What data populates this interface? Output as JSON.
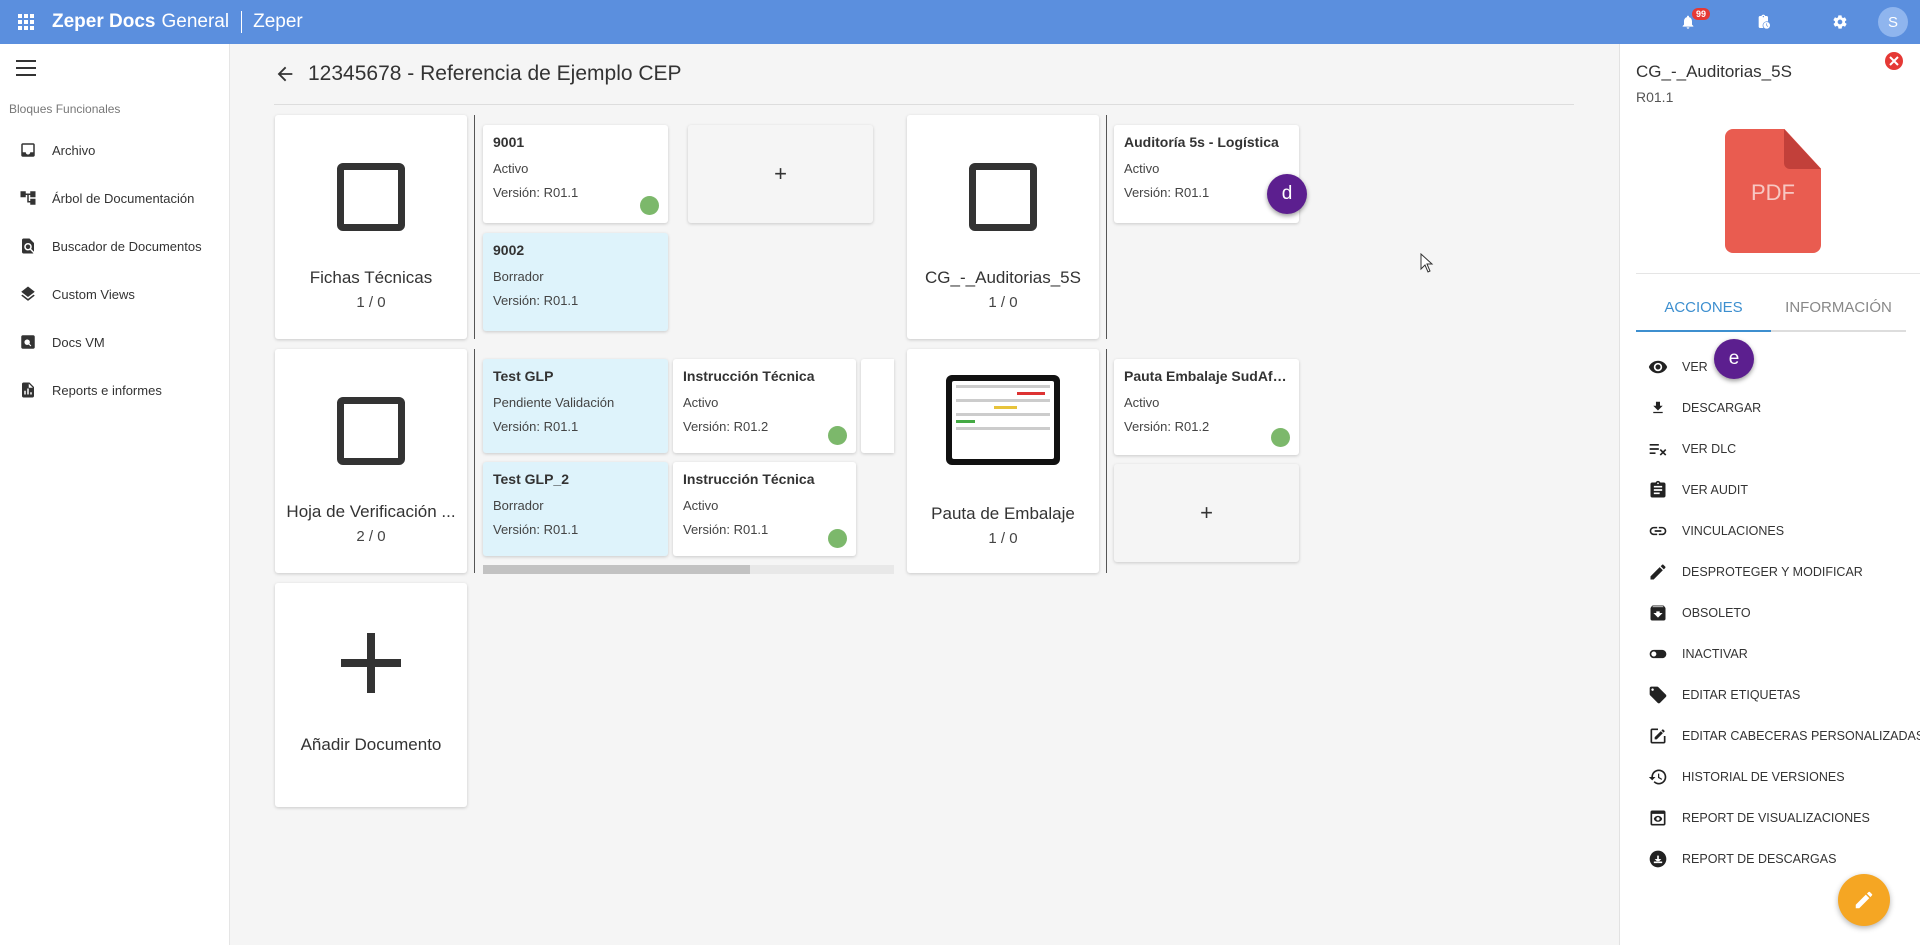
{
  "topbar": {
    "brand_bold": "Zeper Docs",
    "brand_light": "General",
    "company": "Zeper",
    "notification_count": "99",
    "avatar_letter": "S",
    "icons": [
      "apps-grid-icon",
      "bell-icon",
      "clipboard-clock-icon",
      "gear-icon"
    ]
  },
  "sidebar": {
    "section_title": "Bloques Funcionales",
    "items": [
      {
        "label": "Archivo",
        "icon": "inbox-icon"
      },
      {
        "label": "Árbol de Documentación",
        "icon": "tree-icon"
      },
      {
        "label": "Buscador de Documentos",
        "icon": "doc-search-icon"
      },
      {
        "label": "Custom Views",
        "icon": "layers-icon"
      },
      {
        "label": "Docs VM",
        "icon": "image-search-icon"
      },
      {
        "label": "Reports e informes",
        "icon": "report-icon"
      }
    ]
  },
  "main": {
    "title": "12345678 - Referencia de Ejemplo CEP",
    "blocks": [
      {
        "name": "Fichas Técnicas",
        "count": "1 / 0"
      },
      {
        "name": "CG_-_Auditorias_5S",
        "count": "1 / 0"
      },
      {
        "name": "Hoja de Verificación ...",
        "count": "2 / 0"
      },
      {
        "name": "Pauta de Embalaje",
        "count": "1 / 0"
      }
    ],
    "add_document_label": "Añadir Documento",
    "add_symbol": "+",
    "docs": [
      {
        "name": "9001",
        "status": "Activo",
        "version": "Versión: R01.1"
      },
      {
        "name": "9002",
        "status": "Borrador",
        "version": "Versión: R01.1"
      },
      {
        "name": "Auditoría 5s - Logística",
        "status": "Activo",
        "version": "Versión: R01.1"
      },
      {
        "name": "Test GLP",
        "status": "Pendiente Validación",
        "version": "Versión: R01.1"
      },
      {
        "name": "Instrucción Técnica",
        "status": "Activo",
        "version": "Versión: R01.2"
      },
      {
        "name": "Test GLP_2",
        "status": "Borrador",
        "version": "Versión: R01.1"
      },
      {
        "name": "Instrucción Técnica",
        "status": "Activo",
        "version": "Versión: R01.1"
      },
      {
        "name": "Pauta Embalaje SudAfri...",
        "status": "Activo",
        "version": "Versión: R01.2"
      }
    ],
    "markers": {
      "d": "d",
      "e": "e"
    },
    "scroll_fraction": 0.65,
    "status_color_active": "#7cb86b",
    "draft_color": "#def3fb"
  },
  "panel": {
    "title": "CG_-_Auditorias_5S",
    "version": "R01.1",
    "file_type": "PDF",
    "tabs": [
      "ACCIONES",
      "INFORMACIÓN"
    ],
    "active_tab": "ACCIONES",
    "actions": [
      {
        "label": "VER",
        "icon": "eye-icon"
      },
      {
        "label": "DESCARGAR",
        "icon": "download-icon"
      },
      {
        "label": "VER DLC",
        "icon": "checklist-icon"
      },
      {
        "label": "VER AUDIT",
        "icon": "clipboard-icon"
      },
      {
        "label": "VINCULACIONES",
        "icon": "link-icon"
      },
      {
        "label": "DESPROTEGER Y MODIFICAR",
        "icon": "pencil-icon"
      },
      {
        "label": "OBSOLETO",
        "icon": "archive-icon"
      },
      {
        "label": "INACTIVAR",
        "icon": "toggle-icon"
      },
      {
        "label": "EDITAR ETIQUETAS",
        "icon": "tags-icon"
      },
      {
        "label": "EDITAR CABECERAS PERSONALIZADAS",
        "icon": "edit-box-icon"
      },
      {
        "label": "HISTORIAL DE VERSIONES",
        "icon": "history-icon"
      },
      {
        "label": "REPORT DE VISUALIZACIONES",
        "icon": "view-report-icon"
      },
      {
        "label": "REPORT DE DESCARGAS",
        "icon": "download-circle-icon"
      }
    ],
    "accent": "#3d8fcf",
    "fab_color": "#f5a623"
  }
}
